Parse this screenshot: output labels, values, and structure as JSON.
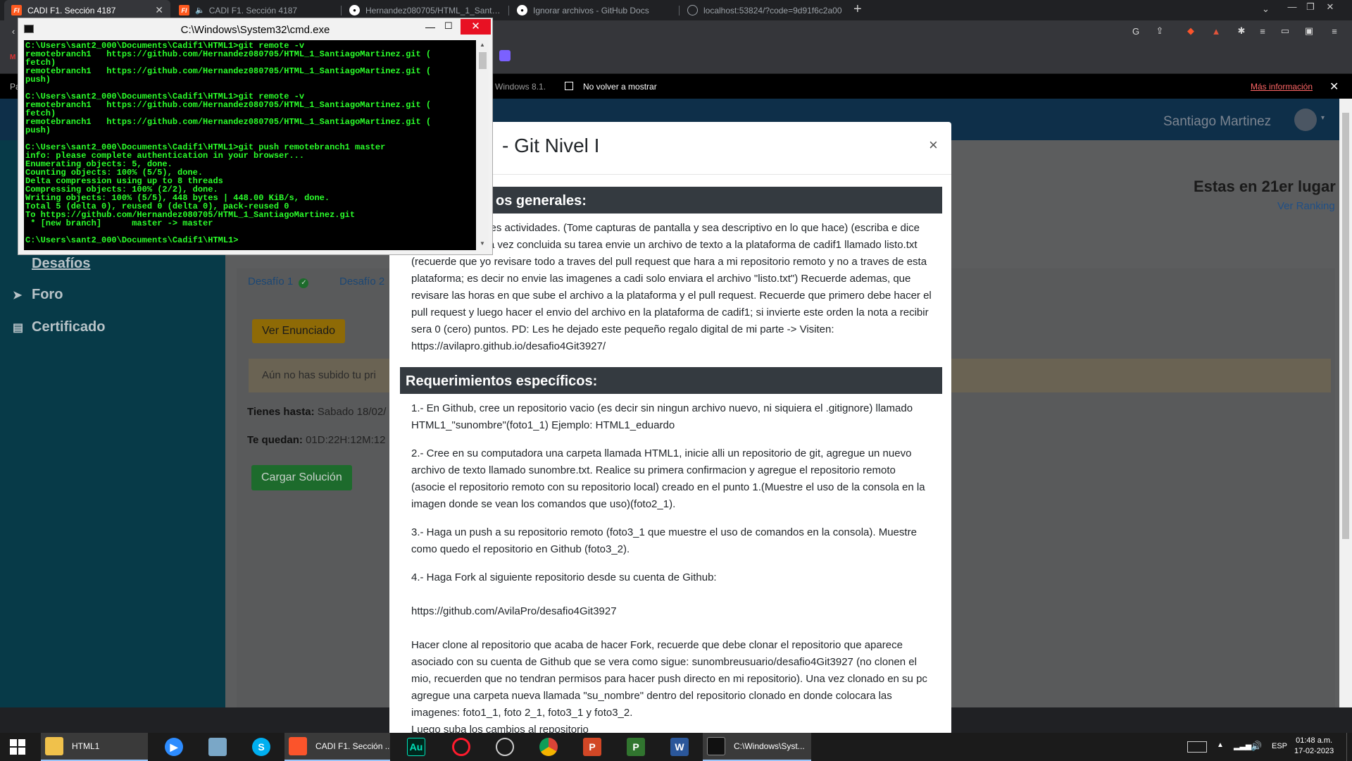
{
  "browser": {
    "tabs": [
      {
        "title": "CADI F1. Sección 4187",
        "icon": "cadi-icon",
        "active": true
      },
      {
        "title": "CADI F1. Sección 4187",
        "icon": "cadi-icon",
        "muted": true
      },
      {
        "title": "Hernandez080705/HTML_1_Santiago",
        "icon": "github-icon"
      },
      {
        "title": "Ignorar archivos - GitHub Docs",
        "icon": "github-icon"
      },
      {
        "title": "localhost:53824/?code=9d91f6c2a00",
        "icon": "globe-icon"
      }
    ],
    "new_tab": "+",
    "notice": {
      "partial_text": "Windows 8.1.",
      "checkbox_label": "No volver a mostrar",
      "link": "Más información",
      "close": "✕"
    },
    "truncated_left": "Pa"
  },
  "page": {
    "user_name": "Santiago Martinez",
    "sidebar": [
      {
        "label": "Desafíos",
        "icon": "flag-icon"
      },
      {
        "label": "Foro",
        "icon": "send-icon"
      },
      {
        "label": "Certificado",
        "icon": "certificate-icon"
      }
    ],
    "rank_title": "Estas en 21er lugar",
    "rank_link": "Ver Ranking",
    "challenge_tabs": [
      {
        "label": "Desafío 1",
        "status_icon": "check-circle-icon"
      },
      {
        "label": "Desafío 2"
      }
    ],
    "statement_button": "Ver Enunciado",
    "alert_text": "Aún no has subido tu pri",
    "deadline_label": "Tienes hasta:",
    "deadline_value": "Sabado 18/02/",
    "remaining_label": "Te quedan:",
    "remaining_value": "01D:22H:12M:12",
    "upload_button": "Cargar Solución"
  },
  "modal": {
    "title": "- Git Nivel I",
    "close": "×",
    "general_heading": "os generales:",
    "general_text": "ntes actividades. (Tome capturas de pantalla y sea descriptivo en lo que hace) (escriba e dice \"su nombre\") Una vez concluida su tarea envie un archivo de texto a la plataforma de cadif1 llamado listo.txt (recuerde que yo revisare todo a traves del pull request que hara a mi repositorio remoto y no a traves de esta plataforma; es decir no envie las imagenes a cadi solo enviara el archivo \"listo.txt\") Recuerde ademas, que revisare las horas en que sube el archivo a la plataforma y el pull request. Recuerde que primero debe hacer el pull request y luego hacer el envio del archivo en la plataforma de cadif1; si invierte este orden la nota a recibir sera 0 (cero) puntos. PD: Les he dejado este pequeño regalo digital de mi parte -> Visiten: https://avilapro.github.io/desafio4Git3927/",
    "specific_heading": "Requerimientos específicos:",
    "steps": [
      "1.- En Github, cree un repositorio vacio (es decir sin ningun archivo nuevo, ni siquiera el .gitignore) llamado HTML1_\"sunombre\"(foto1_1) Ejemplo: HTML1_eduardo",
      "2.- Cree en su computadora una carpeta llamada HTML1, inicie alli un repositorio de git, agregue un nuevo archivo de texto llamado sunombre.txt. Realice su primera confirmacion y agregue el repositorio remoto (asocie el repositorio remoto con su repositorio local) creado en el punto 1.(Muestre el uso de la consola en la imagen donde se vean los comandos que uso)(foto2_1).",
      "3.- Haga un push a su repositorio remoto (foto3_1 que muestre el uso de comandos en la consola). Muestre como quedo el repositorio en Github (foto3_2).",
      "4.- Haga Fork al siguiente repositorio desde su cuenta de Github:",
      "https://github.com/AvilaPro/desafio4Git3927",
      "Hacer clone al repositorio que acaba de hacer Fork, recuerde que debe clonar el repositorio que aparece asociado con su cuenta de Github que se vera como sigue: sunombreusuario/desafio4Git3927 (no clonen el mio, recuerden que no tendran permisos para hacer push directo en mi repositorio). Una vez clonado en su pc agregue una carpeta nueva llamada \"su_nombre\" dentro del repositorio clonado en donde colocara las imagenes: foto1_1, foto 2_1, foto3_1 y foto3_2.",
      "Luego suba los cambios al repositorio"
    ]
  },
  "cmd": {
    "title": "C:\\Windows\\System32\\cmd.exe",
    "lines": [
      "C:\\Users\\sant2_000\\Documents\\Cadif1\\HTML1>git remote -v",
      "remotebranch1   https://github.com/Hernandez080705/HTML_1_SantiagoMartinez.git (",
      "fetch)",
      "remotebranch1   https://github.com/Hernandez080705/HTML_1_SantiagoMartinez.git (",
      "push)",
      "",
      "C:\\Users\\sant2_000\\Documents\\Cadif1\\HTML1>git remote -v",
      "remotebranch1   https://github.com/Hernandez080705/HTML_1_SantiagoMartinez.git (",
      "fetch)",
      "remotebranch1   https://github.com/Hernandez080705/HTML_1_SantiagoMartinez.git (",
      "push)",
      "",
      "C:\\Users\\sant2_000\\Documents\\Cadif1\\HTML1>git push remotebranch1 master",
      "info: please complete authentication in your browser...",
      "Enumerating objects: 5, done.",
      "Counting objects: 100% (5/5), done.",
      "Delta compression using up to 8 threads",
      "Compressing objects: 100% (2/2), done.",
      "Writing objects: 100% (5/5), 448 bytes | 448.00 KiB/s, done.",
      "Total 5 (delta 0), reused 0 (delta 0), pack-reused 0",
      "To https://github.com/Hernandez080705/HTML_1_SantiagoMartinez.git",
      " * [new branch]      master -> master",
      "",
      "C:\\Users\\sant2_000\\Documents\\Cadif1\\HTML1>"
    ]
  },
  "taskbar": {
    "apps": [
      {
        "name": "start-button",
        "label": ""
      },
      {
        "name": "file-explorer",
        "label": "HTML1"
      },
      {
        "name": "zoom",
        "label": ""
      },
      {
        "name": "control-panel",
        "label": ""
      },
      {
        "name": "skype",
        "label": ""
      },
      {
        "name": "brave",
        "label": "CADI F1. Sección ..."
      },
      {
        "name": "audition",
        "label": ""
      },
      {
        "name": "opera",
        "label": ""
      },
      {
        "name": "opera-gx",
        "label": ""
      },
      {
        "name": "chrome",
        "label": ""
      },
      {
        "name": "powerpoint",
        "label": ""
      },
      {
        "name": "project",
        "label": ""
      },
      {
        "name": "word",
        "label": ""
      },
      {
        "name": "cmd",
        "label": "C:\\Windows\\Syst..."
      }
    ],
    "language": "ESP",
    "time": "01:48 a.m.",
    "date": "17-02-2023"
  }
}
